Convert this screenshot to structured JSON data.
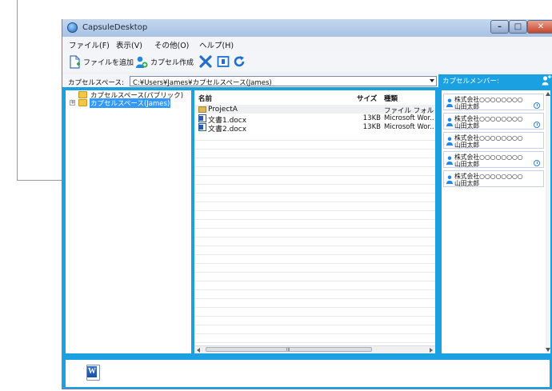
{
  "window": {
    "title": "CapsuleDesktop"
  },
  "menu": {
    "items": [
      "ファイル(F)",
      "表示(V)",
      "その他(O)",
      "ヘルプ(H)"
    ]
  },
  "toolbar": {
    "add_file_label": "ファイルを追加",
    "create_capsule_label": "カプセル作成"
  },
  "path_bar": {
    "label": "カプセルスペース:",
    "value": "C:¥Users¥James¥カプセルスペース(James)"
  },
  "tree": {
    "items": [
      {
        "label": "カプセルスペース(パブリック)"
      },
      {
        "label": "カプセルスペース(James)"
      }
    ]
  },
  "file_list": {
    "columns": [
      "名前",
      "サイズ",
      "種類"
    ],
    "rows": [
      {
        "name": "ProjectA",
        "size": "",
        "type": "ファイル フォルダー",
        "icon": "folder-icon"
      },
      {
        "name": "文書1.docx",
        "size": "13KB",
        "type": "Microsoft Wor...",
        "icon": "word-doc-icon"
      },
      {
        "name": "文書2.docx",
        "size": "13KB",
        "type": "Microsoft Wor...",
        "icon": "word-doc-icon"
      }
    ]
  },
  "members": {
    "title": "カプセルメンバー:",
    "cards": [
      {
        "company": "株式会社○○○○○○○○",
        "name": "山田太郎",
        "pending": true
      },
      {
        "company": "株式会社○○○○○○○○",
        "name": "山田太郎",
        "pending": true
      },
      {
        "company": "株式会社○○○○○○○○",
        "name": "山田太郎",
        "pending": false
      },
      {
        "company": "株式会社○○○○○○○○",
        "name": "山田太郎",
        "pending": true
      },
      {
        "company": "株式会社○○○○○○○○",
        "name": "山田太郎",
        "pending": false
      }
    ]
  },
  "colors": {
    "frame_blue": "#1ba1e2",
    "selection": "#3399ff",
    "close_red": "#c4442a"
  }
}
